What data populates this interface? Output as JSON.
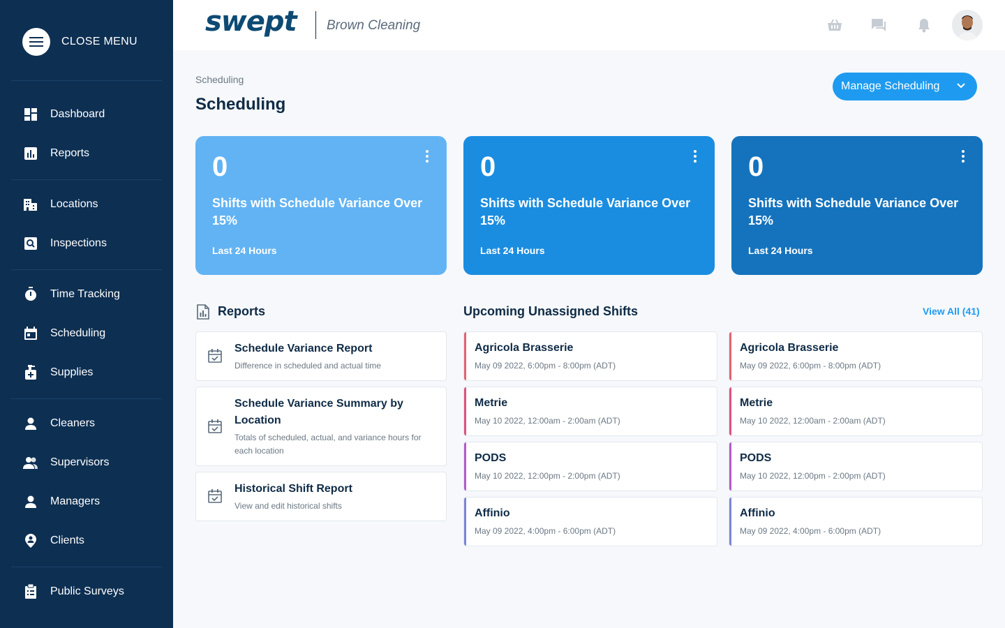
{
  "sidebar": {
    "menu_label": "CLOSE MENU",
    "items": [
      {
        "label": "Dashboard",
        "icon": "dashboard-icon"
      },
      {
        "label": "Reports",
        "icon": "reports-icon"
      },
      {
        "label": "Locations",
        "icon": "building-icon"
      },
      {
        "label": "Inspections",
        "icon": "inspection-icon"
      },
      {
        "label": "Time Tracking",
        "icon": "stopwatch-icon"
      },
      {
        "label": "Scheduling",
        "icon": "calendar-icon"
      },
      {
        "label": "Supplies",
        "icon": "supplies-icon"
      },
      {
        "label": "Cleaners",
        "icon": "person-icon"
      },
      {
        "label": "Supervisors",
        "icon": "people-icon"
      },
      {
        "label": "Managers",
        "icon": "person-icon"
      },
      {
        "label": "Clients",
        "icon": "client-pin-icon"
      },
      {
        "label": "Public Surveys",
        "icon": "clipboard-icon"
      }
    ]
  },
  "header": {
    "logo": "swept",
    "company": "Brown Cleaning",
    "icons": [
      "basket-icon",
      "chat-icon",
      "bell-icon",
      "avatar"
    ]
  },
  "page": {
    "breadcrumb": "Scheduling",
    "title": "Scheduling",
    "manage_label": "Manage Scheduling"
  },
  "stats": [
    {
      "value": "0",
      "title": "Shifts with Schedule Variance Over 15%",
      "subtitle": "Last 24 Hours",
      "color": "#62b3f4"
    },
    {
      "value": "0",
      "title": "Shifts with Schedule Variance Over 15%",
      "subtitle": "Last 24 Hours",
      "color": "#1b8de0"
    },
    {
      "value": "0",
      "title": "Shifts with Schedule Variance Over 15%",
      "subtitle": "Last 24 Hours",
      "color": "#1573bd"
    }
  ],
  "reports": {
    "title": "Reports",
    "items": [
      {
        "title": "Schedule Variance Report",
        "desc": "Difference in scheduled and actual time"
      },
      {
        "title": "Schedule Variance Summary by Location",
        "desc": "Totals of scheduled, actual, and variance hours for each location"
      },
      {
        "title": "Historical Shift Report",
        "desc": "View and edit historical shifts"
      }
    ]
  },
  "shifts": {
    "title": "Upcoming Unassigned Shifts",
    "view_all": "View All (41)",
    "items": [
      {
        "name": "Agricola Brasserie",
        "time": "May 09 2022, 6:00pm - 8:00pm (ADT)",
        "color": "#e2636f"
      },
      {
        "name": "Agricola Brasserie",
        "time": "May 09 2022, 6:00pm - 8:00pm (ADT)",
        "color": "#e2636f"
      },
      {
        "name": "Metrie",
        "time": "May 10 2022, 12:00am - 2:00am (ADT)",
        "color": "#e0507e"
      },
      {
        "name": "Metrie",
        "time": "May 10 2022, 12:00am - 2:00am (ADT)",
        "color": "#e0507e"
      },
      {
        "name": "PODS",
        "time": "May 10 2022, 12:00pm - 2:00pm (ADT)",
        "color": "#b45bc9"
      },
      {
        "name": "PODS",
        "time": "May 10 2022, 12:00pm - 2:00pm (ADT)",
        "color": "#b45bc9"
      },
      {
        "name": "Affinio",
        "time": "May 09 2022, 4:00pm - 6:00pm (ADT)",
        "color": "#7b86d6"
      },
      {
        "name": "Affinio",
        "time": "May 09 2022, 4:00pm - 6:00pm (ADT)",
        "color": "#7b86d6"
      }
    ]
  }
}
